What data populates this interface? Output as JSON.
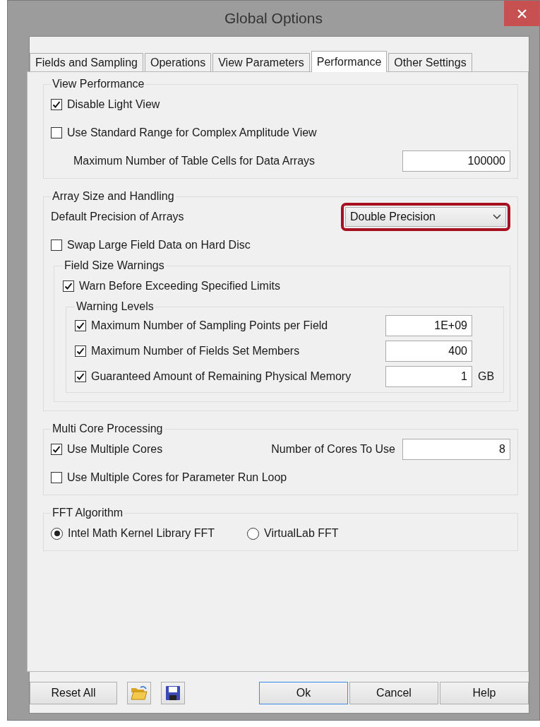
{
  "window": {
    "title": "Global Options"
  },
  "tabs": [
    {
      "label": "Fields and Sampling",
      "selected": false
    },
    {
      "label": "Operations",
      "selected": false
    },
    {
      "label": "View Parameters",
      "selected": false
    },
    {
      "label": "Performance",
      "selected": true
    },
    {
      "label": "Other Settings",
      "selected": false
    }
  ],
  "groups": [
    {
      "title": "View Performance",
      "items": [
        {
          "kind": "checkbox",
          "label": "Disable Light View",
          "checked": true
        },
        {
          "kind": "checkbox",
          "label": "Use Standard Range for Complex Amplitude View",
          "checked": false
        },
        {
          "kind": "number",
          "label": "Maximum Number of Table Cells for Data Arrays",
          "value": "100000"
        }
      ]
    },
    {
      "title": "Array Size and Handling",
      "items": [
        {
          "kind": "dropdown",
          "label": "Default Precision of Arrays",
          "value": "Double Precision",
          "highlighted": true
        },
        {
          "kind": "checkbox",
          "label": "Swap Large Field Data on Hard Disc",
          "checked": false
        },
        {
          "kind": "group",
          "title": "Field Size Warnings",
          "items": [
            {
              "kind": "checkbox",
              "label": "Warn Before Exceeding Specified Limits",
              "checked": true
            },
            {
              "kind": "group",
              "title": "Warning Levels",
              "items": [
                {
                  "kind": "check_number",
                  "label": "Maximum Number of Sampling Points per Field",
                  "checked": true,
                  "value": "1E+09"
                },
                {
                  "kind": "check_number",
                  "label": "Maximum Number of Fields Set Members",
                  "checked": true,
                  "value": "400"
                },
                {
                  "kind": "check_number",
                  "label": "Guaranteed Amount of Remaining Physical Memory",
                  "checked": true,
                  "value": "1",
                  "unit": "GB"
                }
              ]
            }
          ]
        }
      ]
    },
    {
      "title": "Multi Core Processing",
      "items": [
        {
          "kind": "check_pair",
          "label": "Use Multiple Cores",
          "checked": true,
          "field_label": "Number of Cores To Use",
          "value": "8"
        },
        {
          "kind": "checkbox",
          "label": "Use Multiple Cores for Parameter Run Loop",
          "checked": false
        }
      ]
    },
    {
      "title": "FFT Algorithm",
      "items": [
        {
          "kind": "radios",
          "options": [
            {
              "label": "Intel Math Kernel Library FFT",
              "selected": true
            },
            {
              "label": "VirtualLab FFT",
              "selected": false
            }
          ]
        }
      ]
    }
  ],
  "footer": {
    "left": [
      {
        "label": "Reset All"
      }
    ],
    "right": [
      {
        "label": "Ok",
        "default": true
      },
      {
        "label": "Cancel",
        "default": false
      },
      {
        "label": "Help",
        "default": false
      }
    ]
  }
}
